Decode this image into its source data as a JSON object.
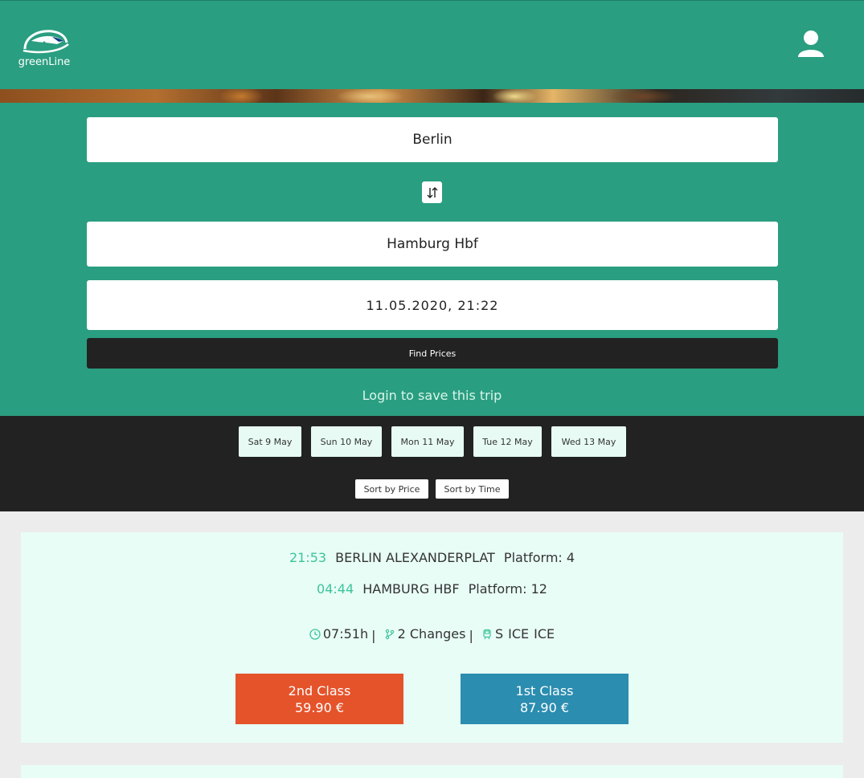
{
  "brand": {
    "name": "greenLine",
    "primary_color": "#2a9e80",
    "accent_color": "#3cc49a"
  },
  "header": {
    "logo_text": "greenLine",
    "user_icon": "user-icon"
  },
  "search": {
    "from": "Berlin",
    "to": "Hamburg Hbf",
    "datetime": "11.05.2020, 21:22",
    "swap_icon": "swap-vertical-icon",
    "find_label": "Find Prices",
    "login_prompt": "Login to save this trip"
  },
  "days": [
    {
      "label": "Sat 9 May"
    },
    {
      "label": "Sun 10 May"
    },
    {
      "label": "Mon 11 May"
    },
    {
      "label": "Tue 12 May"
    },
    {
      "label": "Wed 13 May"
    }
  ],
  "sort": {
    "by_price": "Sort by Price",
    "by_time": "Sort by Time"
  },
  "results": [
    {
      "departure": {
        "time": "21:53",
        "station": "BERLIN ALEXANDERPLAT",
        "platform": "Platform: 4"
      },
      "arrival": {
        "time": "04:44",
        "station": "HAMBURG HBF",
        "platform": "Platform: 12"
      },
      "duration": "07:51h",
      "changes": "2 Changes",
      "products": [
        "S",
        "ICE",
        "ICE"
      ],
      "second_class": {
        "label": "2nd Class",
        "price": "59.90 €",
        "color": "#e5532b"
      },
      "first_class": {
        "label": "1st Class",
        "price": "87.90 €",
        "color": "#2b8db0"
      }
    }
  ]
}
